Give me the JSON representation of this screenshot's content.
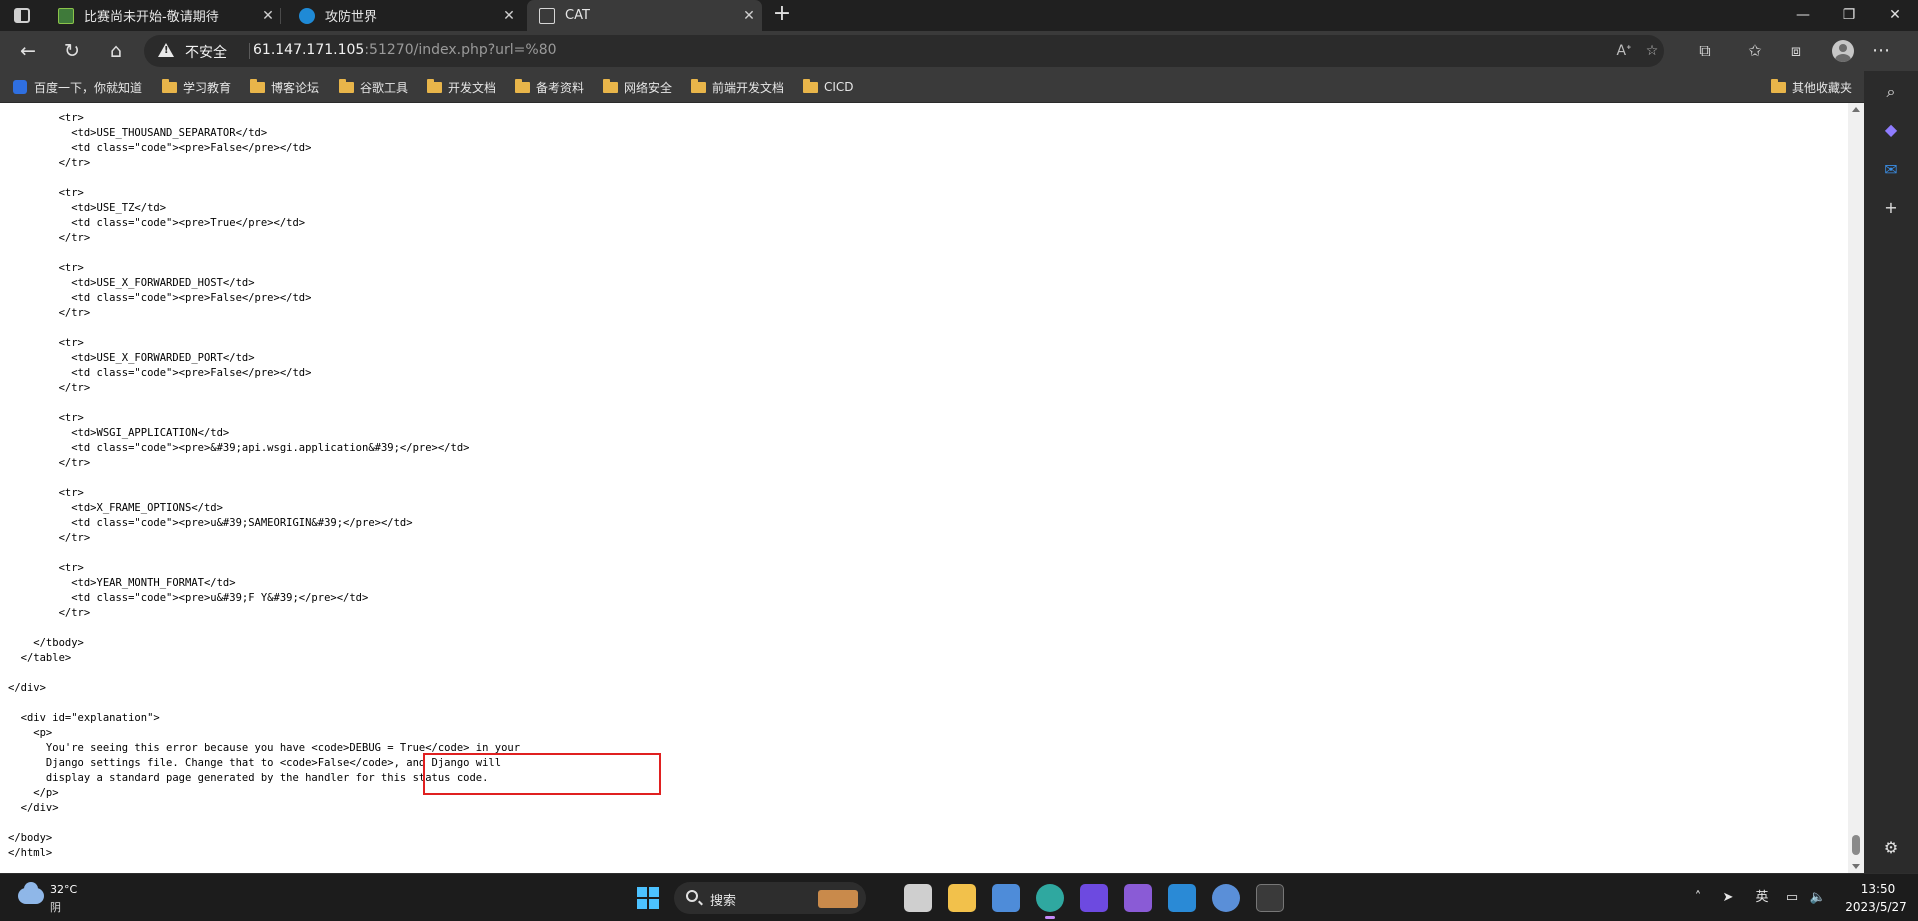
{
  "tabs": [
    {
      "title": "比赛尚未开始-敬请期待",
      "close": "✕"
    },
    {
      "title": "攻防世界",
      "close": "✕"
    },
    {
      "title": "CAT",
      "close": "✕"
    }
  ],
  "new_tab": "+",
  "window_controls": {
    "minimize": "—",
    "maximize": "❐",
    "close": "✕"
  },
  "address": {
    "security_label": "不安全",
    "url_host": "61.147.171.105",
    "url_rest": ":51270/index.php?url=%80"
  },
  "bookmarks": [
    "百度一下，你就知道",
    "学习教育",
    "博客论坛",
    "谷歌工具",
    "开发文档",
    "备考资料",
    "网络安全",
    "前端开发文档",
    "CICD"
  ],
  "other_bookmarks": "其他收藏夹",
  "source_lines": [
    "        <tr>",
    "          <td>USE_THOUSAND_SEPARATOR</td>",
    "          <td class=\"code\"><pre>False</pre></td>",
    "        </tr>",
    "",
    "        <tr>",
    "          <td>USE_TZ</td>",
    "          <td class=\"code\"><pre>True</pre></td>",
    "        </tr>",
    "",
    "        <tr>",
    "          <td>USE_X_FORWARDED_HOST</td>",
    "          <td class=\"code\"><pre>False</pre></td>",
    "        </tr>",
    "",
    "        <tr>",
    "          <td>USE_X_FORWARDED_PORT</td>",
    "          <td class=\"code\"><pre>False</pre></td>",
    "        </tr>",
    "",
    "        <tr>",
    "          <td>WSGI_APPLICATION</td>",
    "          <td class=\"code\"><pre>&#39;api.wsgi.application&#39;</pre></td>",
    "        </tr>",
    "",
    "        <tr>",
    "          <td>X_FRAME_OPTIONS</td>",
    "          <td class=\"code\"><pre>u&#39;SAMEORIGIN&#39;</pre></td>",
    "        </tr>",
    "",
    "        <tr>",
    "          <td>YEAR_MONTH_FORMAT</td>",
    "          <td class=\"code\"><pre>u&#39;F Y&#39;</pre></td>",
    "        </tr>",
    "",
    "    </tbody>",
    "  </table>",
    "",
    "</div>",
    "",
    "  <div id=\"explanation\">",
    "    <p>",
    "      You're seeing this error because you have <code>DEBUG = True</code> in your",
    "      Django settings file. Change that to <code>False</code>, and Django will",
    "      display a standard page generated by the handler for this status code.",
    "    </p>",
    "  </div>",
    "",
    "</body>",
    "</html>"
  ],
  "taskbar": {
    "weather_temp": "32°C",
    "weather_desc": "阴",
    "search_label": "搜索",
    "ime": "英",
    "time": "13:50",
    "date": "2023/5/27"
  }
}
